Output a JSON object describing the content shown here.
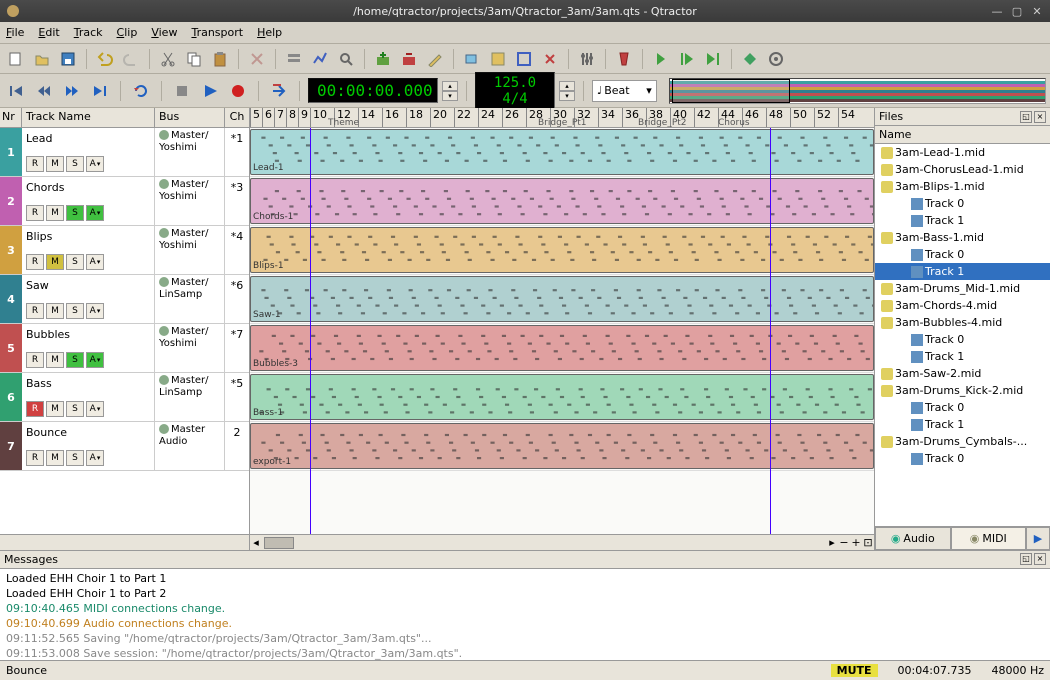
{
  "title": "/home/qtractor/projects/3am/Qtractor_3am/3am.qts - Qtractor",
  "menu": [
    "File",
    "Edit",
    "Track",
    "Clip",
    "View",
    "Transport",
    "Help"
  ],
  "transport": {
    "time": "00:00:00.000",
    "tempo": "125.0 4/4",
    "snap_label": "Beat"
  },
  "track_header": {
    "nr": "Nr",
    "name": "Track Name",
    "bus": "Bus",
    "ch": "Ch"
  },
  "tracks": [
    {
      "nr": "1",
      "name": "Lead",
      "bus": "Master/\nYoshimi",
      "ch": "*1",
      "color": "#3aa0a0",
      "clip_label": "Lead-1",
      "clip_color": "#a8d8d8",
      "r": false,
      "m": false,
      "s": false
    },
    {
      "nr": "2",
      "name": "Chords",
      "bus": "Master/\nYoshimi",
      "ch": "*3",
      "color": "#c060b0",
      "clip_label": "Chords-1",
      "clip_color": "#e0b0d0",
      "r": false,
      "m": false,
      "s": true
    },
    {
      "nr": "3",
      "name": "Blips",
      "bus": "Master/\nYoshimi",
      "ch": "*4",
      "color": "#d0a040",
      "clip_label": "Blips-1",
      "clip_color": "#e8c890",
      "r": false,
      "m": true,
      "s": false
    },
    {
      "nr": "4",
      "name": "Saw",
      "bus": "Master/\nLinSamp",
      "ch": "*6",
      "color": "#308090",
      "clip_label": "Saw-1",
      "clip_color": "#b0d0d0",
      "r": false,
      "m": false,
      "s": false
    },
    {
      "nr": "5",
      "name": "Bubbles",
      "bus": "Master/\nYoshimi",
      "ch": "*7",
      "color": "#c05050",
      "clip_label": "Bubbles-3",
      "clip_color": "#e0a0a0",
      "r": false,
      "m": false,
      "s": true
    },
    {
      "nr": "6",
      "name": "Bass",
      "bus": "Master/\nLinSamp",
      "ch": "*5",
      "color": "#30a070",
      "clip_label": "Bass-1",
      "clip_color": "#a0d8b8",
      "r": true,
      "m": false,
      "s": false
    },
    {
      "nr": "7",
      "name": "Bounce",
      "bus": "Master\nAudio",
      "ch": "2",
      "color": "#604040",
      "clip_label": "export-1",
      "clip_color": "#d8a8a0",
      "r": false,
      "m": false,
      "s": false
    }
  ],
  "ruler_ticks": [
    5,
    6,
    7,
    8,
    9,
    10,
    12,
    14,
    16,
    18,
    20,
    22,
    24,
    26,
    28,
    30,
    32,
    34,
    36,
    38,
    40,
    42,
    44,
    46,
    48,
    50,
    52,
    54
  ],
  "ruler_markers": [
    {
      "pos": 78,
      "label": "Theme"
    },
    {
      "pos": 288,
      "label": "Bridge_Pt1"
    },
    {
      "pos": 388,
      "label": "Bridge_Pt2"
    },
    {
      "pos": 468,
      "label": "Chorus"
    }
  ],
  "files_title": "Files",
  "files_col": "Name",
  "files": [
    {
      "lvl": 1,
      "type": "mid",
      "name": "3am-Lead-1.mid"
    },
    {
      "lvl": 1,
      "type": "mid",
      "name": "3am-ChorusLead-1.mid"
    },
    {
      "lvl": 1,
      "type": "mid",
      "name": "3am-Blips-1.mid"
    },
    {
      "lvl": 2,
      "type": "trk",
      "name": "Track 0"
    },
    {
      "lvl": 2,
      "type": "trk",
      "name": "Track 1"
    },
    {
      "lvl": 1,
      "type": "mid",
      "name": "3am-Bass-1.mid"
    },
    {
      "lvl": 2,
      "type": "trk",
      "name": "Track 0"
    },
    {
      "lvl": 2,
      "type": "trk",
      "name": "Track 1",
      "sel": true
    },
    {
      "lvl": 1,
      "type": "mid",
      "name": "3am-Drums_Mid-1.mid"
    },
    {
      "lvl": 1,
      "type": "mid",
      "name": "3am-Chords-4.mid"
    },
    {
      "lvl": 1,
      "type": "mid",
      "name": "3am-Bubbles-4.mid"
    },
    {
      "lvl": 2,
      "type": "trk",
      "name": "Track 0"
    },
    {
      "lvl": 2,
      "type": "trk",
      "name": "Track 1"
    },
    {
      "lvl": 1,
      "type": "mid",
      "name": "3am-Saw-2.mid"
    },
    {
      "lvl": 1,
      "type": "mid",
      "name": "3am-Drums_Kick-2.mid"
    },
    {
      "lvl": 2,
      "type": "trk",
      "name": "Track 0"
    },
    {
      "lvl": 2,
      "type": "trk",
      "name": "Track 1"
    },
    {
      "lvl": 1,
      "type": "mid",
      "name": "3am-Drums_Cymbals-..."
    },
    {
      "lvl": 2,
      "type": "trk",
      "name": "Track 0"
    }
  ],
  "file_tabs": {
    "audio": "Audio",
    "midi": "MIDI"
  },
  "messages_title": "Messages",
  "messages": [
    {
      "cls": "",
      "text": "Loaded EHH Choir 1 to Part 1"
    },
    {
      "cls": "",
      "text": "Loaded EHH Choir 1 to Part 2"
    },
    {
      "cls": "midi",
      "text": "09:10:40.465 MIDI connections change."
    },
    {
      "cls": "audio",
      "text": "09:10:40.699 Audio connections change."
    },
    {
      "cls": "sys",
      "text": "09:11:52.565 Saving \"/home/qtractor/projects/3am/Qtractor_3am/3am.qts\"..."
    },
    {
      "cls": "sys",
      "text": "09:11:53.008 Save session: \"/home/qtractor/projects/3am/Qtractor_3am/3am.qts\"."
    }
  ],
  "status": {
    "track": "Bounce",
    "mute": "MUTE",
    "time": "00:04:07.735",
    "rate": "48000 Hz"
  },
  "icons": {}
}
